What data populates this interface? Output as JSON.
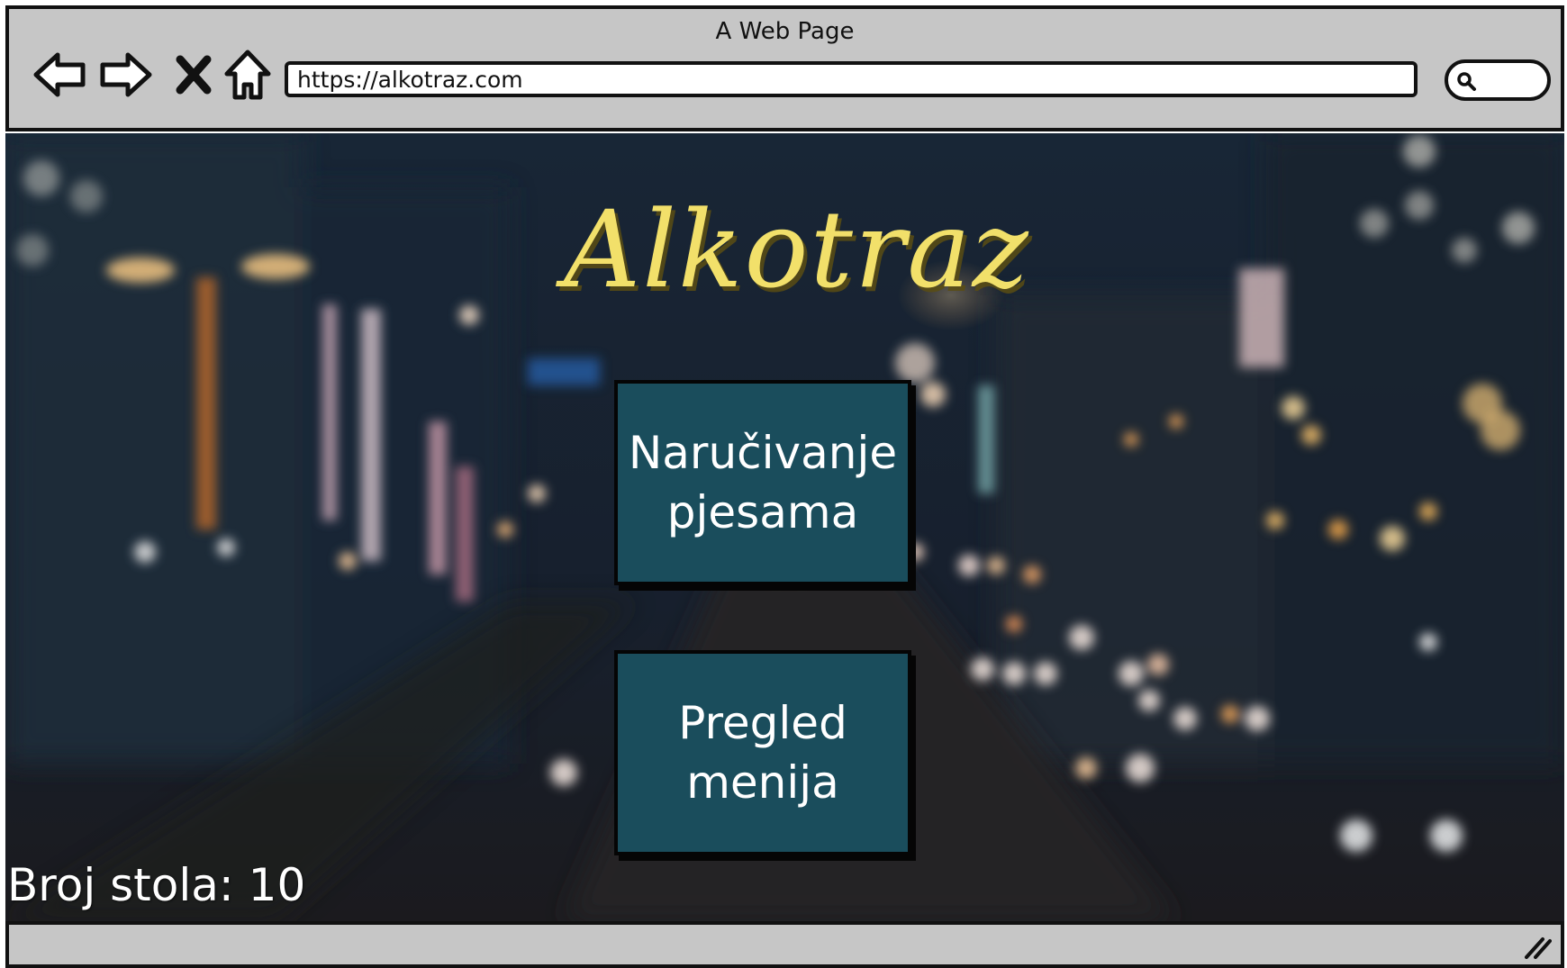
{
  "window": {
    "title": "A Web Page"
  },
  "toolbar": {
    "icons": [
      "back-icon",
      "forward-icon",
      "stop-icon",
      "home-icon"
    ],
    "url": "https://alkotraz.com",
    "search_icon": "search-icon"
  },
  "main": {
    "logo": "Alkotraz",
    "buttons": [
      {
        "label": "Naručivanje pjesama"
      },
      {
        "label": "Pregled menija"
      }
    ],
    "table_number": "Broj stola: 10"
  },
  "colors": {
    "chrome": "#c6c6c6",
    "logo": "#f2e06a",
    "button_bg": "#1a4d5c",
    "background": "#17202c"
  },
  "statusbar": {
    "icon": "resize-grip-icon"
  }
}
